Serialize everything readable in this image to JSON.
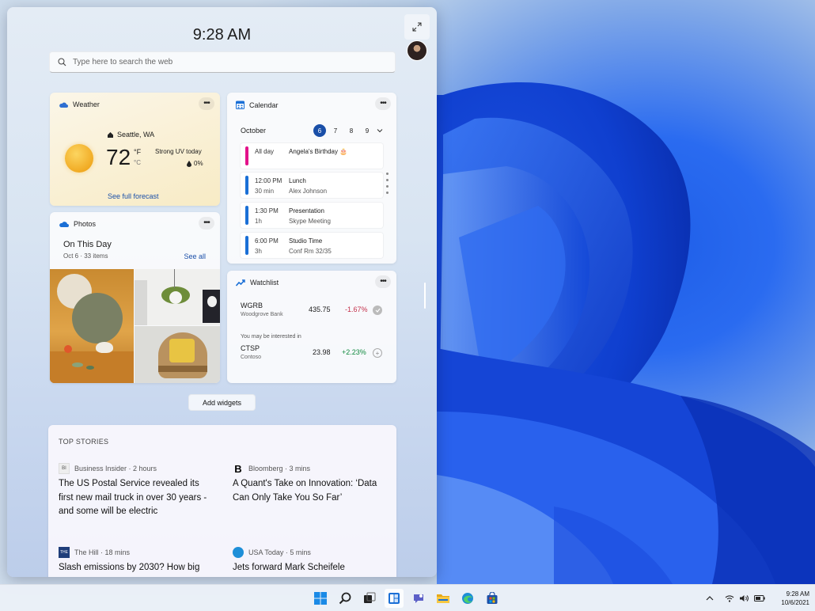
{
  "clock": "9:28 AM",
  "search": {
    "placeholder": "Type here to search the web"
  },
  "weather": {
    "title": "Weather",
    "location": "Seattle, WA",
    "temperature": "72",
    "unit_f": "°F",
    "unit_c": "°C",
    "condition": "Strong UV today",
    "precip": "0%",
    "forecast_link": "See full forecast"
  },
  "photos": {
    "title": "Photos",
    "heading": "On This Day",
    "subtitle": "Oct 6  ·  33 items",
    "see_all": "See all"
  },
  "calendar": {
    "title": "Calendar",
    "month": "October",
    "days": [
      "6",
      "7",
      "8",
      "9"
    ],
    "events": [
      {
        "time": "All day",
        "duration": "",
        "name": "Angela's Birthday 🎂",
        "detail": "",
        "color": "#e3128a"
      },
      {
        "time": "12:00 PM",
        "duration": "30 min",
        "name": "Lunch",
        "detail": "Alex Johnson",
        "color": "#1a6fd6"
      },
      {
        "time": "1:30 PM",
        "duration": "1h",
        "name": "Presentation",
        "detail": "Skype Meeting",
        "color": "#1a6fd6"
      },
      {
        "time": "6:00 PM",
        "duration": "3h",
        "name": "Studio Time",
        "detail": "Conf Rm 32/35",
        "color": "#1a6fd6"
      }
    ]
  },
  "watchlist": {
    "title": "Watchlist",
    "stocks": [
      {
        "symbol": "WGRB",
        "company": "Woodgrove Bank",
        "price": "435.75",
        "change": "-1.67%",
        "color": "#c4314b"
      },
      {
        "symbol": "CTSP",
        "company": "Contoso",
        "price": "23.98",
        "change": "+2.23%",
        "color": "#10893e"
      }
    ],
    "interest_label": "You may be interested in"
  },
  "add_widgets": "Add widgets",
  "top_stories": {
    "heading": "TOP STORIES",
    "stories": [
      {
        "source": "Business Insider · 2 hours",
        "headline": "The US Postal Service revealed its first new mail truck in over 30 years - and some will be electric"
      },
      {
        "source": "Bloomberg · 3 mins",
        "headline": "A Quant's Take on Innovation: ‘Data Can Only Take You So Far’"
      },
      {
        "source": "The Hill · 18 mins",
        "headline": "Slash emissions by 2030? How big"
      },
      {
        "source": "USA Today · 5 mins",
        "headline": "Jets forward Mark Scheifele"
      }
    ]
  },
  "taskbar": {
    "time": "9:28 AM",
    "date": "10/6/2021",
    "icons": [
      "start-icon",
      "search-icon",
      "task-view-icon",
      "widgets-icon",
      "chat-icon",
      "file-explorer-icon",
      "edge-icon",
      "store-icon"
    ]
  },
  "colors": {
    "accent": "#1a4fa8",
    "link": "#1a4fa8",
    "negative": "#c4314b",
    "positive": "#10893e"
  }
}
